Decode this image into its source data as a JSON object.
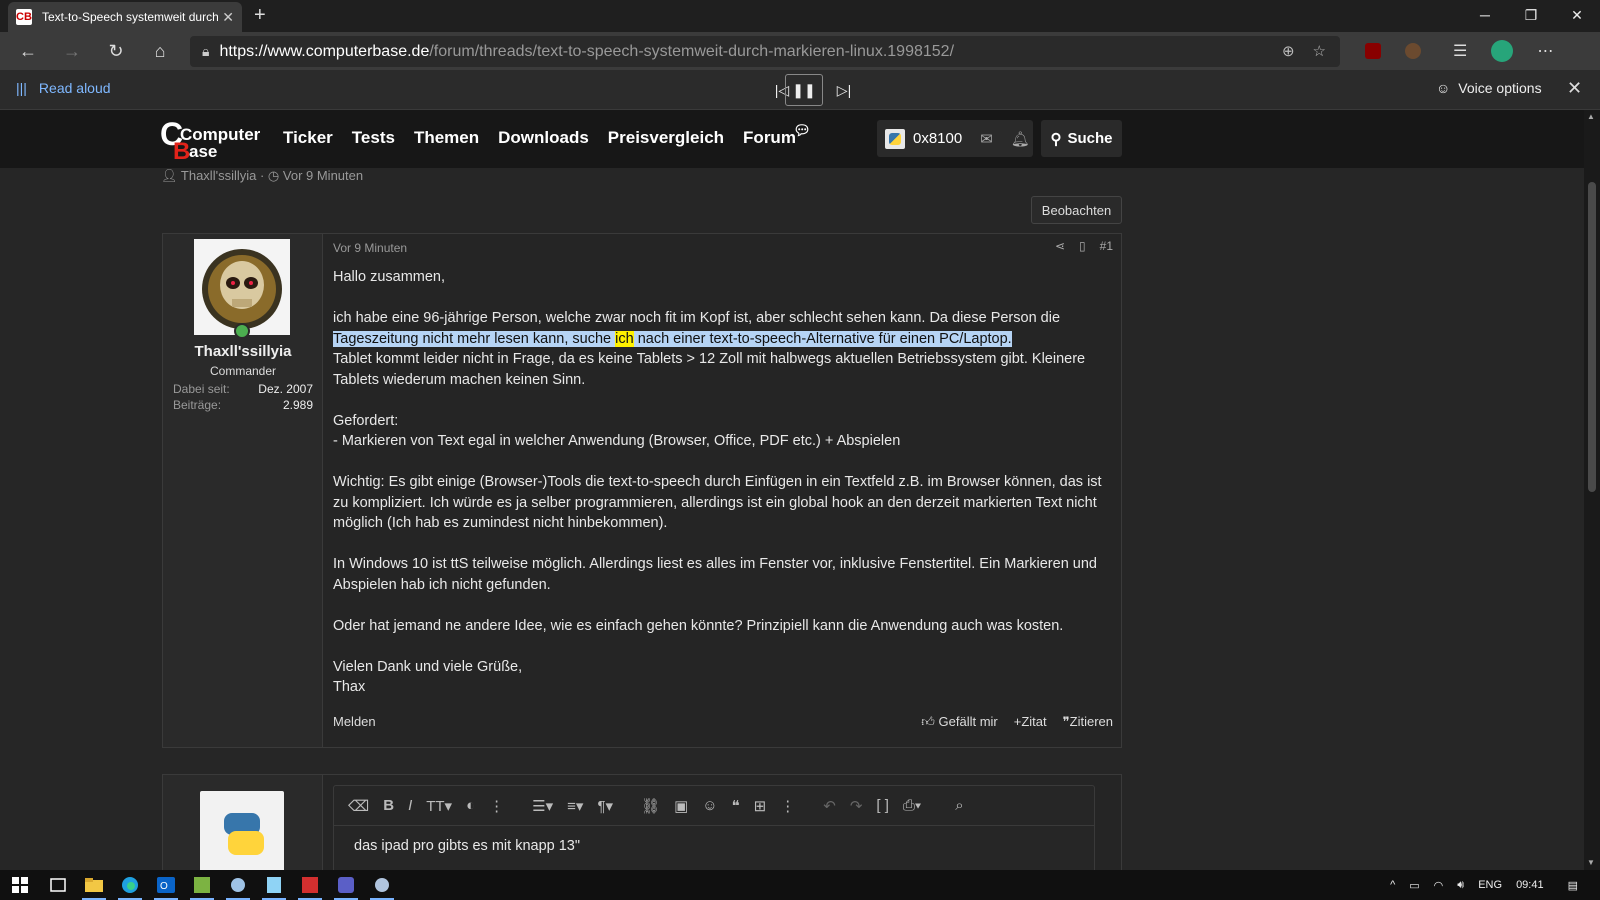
{
  "browser": {
    "tab_title": "Text-to-Speech systemweit durch",
    "tab_favicon": "CB",
    "url_host": "https://www.computerbase.de",
    "url_path": "/forum/threads/text-to-speech-systemweit-durch-markieren-linux.1998152/"
  },
  "read_aloud": {
    "label": "Read aloud",
    "voice_options": "Voice options"
  },
  "site": {
    "logo_line1": "Computer",
    "logo_line2": "Base",
    "menu": [
      "Ticker",
      "Tests",
      "Themen",
      "Downloads",
      "Preisvergleich",
      "Forum"
    ],
    "username": "0x8100",
    "search_label": "Suche"
  },
  "thread": {
    "author": "Thaxll'ssillyia",
    "age": "Vor 9 Minuten",
    "watch_label": "Beobachten"
  },
  "post": {
    "user": {
      "name": "Thaxll'ssillyia",
      "rank": "Commander",
      "joined_label": "Dabei seit:",
      "joined_value": "Dez. 2007",
      "posts_label": "Beiträge:",
      "posts_value": "2.989"
    },
    "time": "Vor 9 Minuten",
    "number": "#1",
    "greeting": "Hallo zusammen,",
    "p1_before": "ich habe eine 96-jährige Person, welche zwar noch fit im Kopf ist, aber schlecht sehen kann. Da diese Person die",
    "p1_hl_a": "Tageszeitung nicht mehr lesen kann, suche ",
    "p1_hl_word": "ich",
    "p1_hl_b": " nach einer text-to-speech-Alternative für einen PC/Laptop.",
    "p1_after": "Tablet kommt leider nicht in Frage, da es keine Tablets > 12 Zoll mit halbwegs aktuellen Betriebssystem gibt. Kleinere Tablets wiederum machen keinen Sinn.",
    "p2_title": "Gefordert:",
    "p2_item": "- Markieren von Text egal in welcher Anwendung (Browser, Office, PDF etc.) + Abspielen",
    "p3": "Wichtig: Es gibt einige (Browser-)Tools die text-to-speech durch Einfügen in ein Textfeld z.B. im Browser können, das ist zu kompliziert. Ich würde es ja selber programmieren, allerdings ist ein global hook an den derzeit markierten Text nicht möglich (Ich hab es zumindest nicht hinbekommen).",
    "p4": "In Windows 10 ist ttS teilweise möglich. Allerdings liest es alles im Fenster vor, inklusive Fenstertitel. Ein Markieren und Abspielen hab ich nicht gefunden.",
    "p5": "Oder hat jemand ne andere Idee, wie es einfach gehen könnte? Prinzipiell kann die Anwendung auch was kosten.",
    "p6_a": "Vielen Dank und viele Grüße,",
    "p6_b": "Thax",
    "report": "Melden",
    "like": "Gefällt mir",
    "quote": "Zitat",
    "cite": "Zitieren"
  },
  "reply": {
    "text": "das ipad pro gibts es mit knapp 13\""
  },
  "taskbar": {
    "lang": "ENG",
    "time": "09:41"
  }
}
